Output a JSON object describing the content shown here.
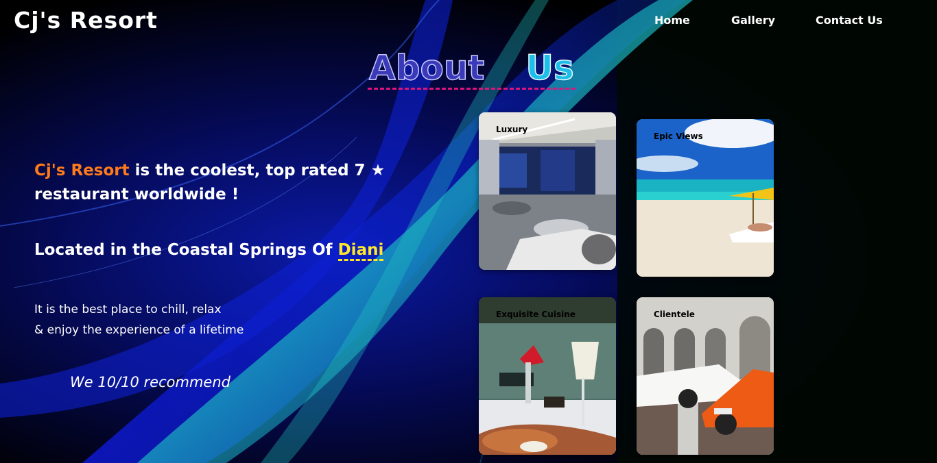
{
  "brand": "Cj's Resort",
  "nav": {
    "home": "Home",
    "gallery": "Gallery",
    "contact": "Contact Us"
  },
  "about": {
    "word1": "About",
    "word2": "Us"
  },
  "intro": {
    "brand_name": "Cj's Resort",
    "text1": "is the coolest, top rated 7",
    "star": "★",
    "text2": "restaurant worldwide !"
  },
  "location": {
    "prefix": "Located in the Coastal Springs Of",
    "place": "Diani"
  },
  "chill": {
    "line1": "It is the best place to chill, relax",
    "line2": "& enjoy the experience of a lifetime"
  },
  "recommend": "We 10/10 recommend",
  "cards": [
    {
      "label": "Luxury"
    },
    {
      "label": "Epic Views"
    },
    {
      "label": "Exquisite Cuisine"
    },
    {
      "label": "Clientele"
    }
  ]
}
